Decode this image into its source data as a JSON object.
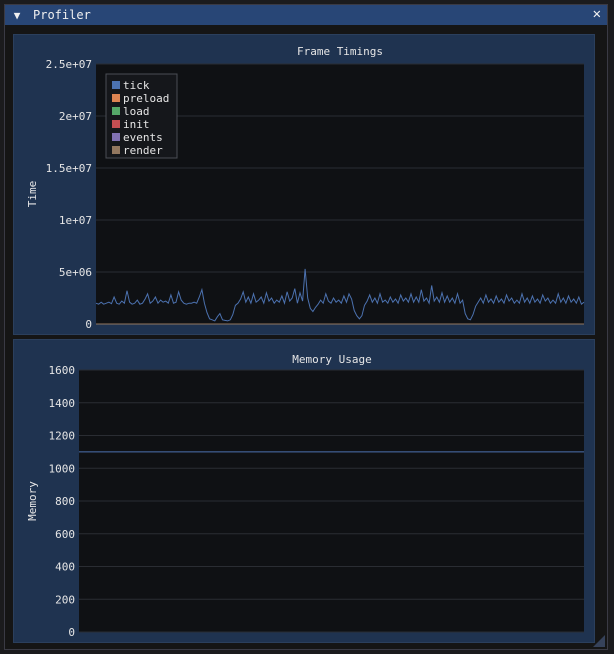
{
  "window": {
    "title": "Profiler",
    "collapse_glyph": "▼",
    "close_glyph": "✕"
  },
  "colors": {
    "titlebar": "#284676",
    "plot_bg": "#0f1114",
    "panel_bg": "#1f3350",
    "tick": "#4c72b0",
    "preload": "#dd8452",
    "load": "#55a868",
    "init": "#c44e52",
    "events": "#8172b3",
    "render": "#937860"
  },
  "chart_data": [
    {
      "type": "line",
      "title": "Frame Timings",
      "xlabel": "",
      "ylabel": "Time",
      "ylim": [
        0,
        25000000
      ],
      "yticks": [
        "0",
        "5e+06",
        "1e+07",
        "1.5e+07",
        "2e+07",
        "2.5e+07"
      ],
      "ytick_values": [
        0,
        5000000,
        10000000,
        15000000,
        20000000,
        25000000
      ],
      "legend": {
        "placement": "top-left"
      },
      "series": [
        {
          "name": "tick",
          "color": "#4c72b0",
          "values": [
            2000000,
            1900000,
            2100000,
            1900000,
            2000000,
            2100000,
            1950000,
            2600000,
            2000000,
            1900000,
            2200000,
            2000000,
            3200000,
            2100000,
            1900000,
            2000000,
            2300000,
            1900000,
            2000000,
            2400000,
            2900000,
            2000000,
            2200000,
            2600000,
            2000000,
            2300000,
            2100000,
            2200000,
            2000000,
            2800000,
            2000000,
            2100000,
            3100000,
            2300000,
            2000000,
            1900000,
            2000000,
            2000000,
            2100000,
            2000000,
            2600000,
            3300000,
            2000000,
            1100000,
            500000,
            400000,
            300000,
            700000,
            1000000,
            400000,
            350000,
            300000,
            400000,
            900000,
            1800000,
            2000000,
            2400000,
            3100000,
            2100000,
            2600000,
            2000000,
            2900000,
            2100000,
            2300000,
            2600000,
            2000000,
            3000000,
            2200000,
            2500000,
            2000000,
            2300000,
            2100000,
            2700000,
            2000000,
            3100000,
            2200000,
            2500000,
            3400000,
            2000000,
            3000000,
            2200000,
            5300000,
            2500000,
            1500000,
            1200000,
            1600000,
            1900000,
            2300000,
            2000000,
            2900000,
            2200000,
            2000000,
            2500000,
            2100000,
            2300000,
            2000000,
            2700000,
            2100000,
            2900000,
            2400000,
            1300000,
            800000,
            500000,
            800000,
            1800000,
            2200000,
            2800000,
            2100000,
            2500000,
            2000000,
            2900000,
            2100000,
            2300000,
            2000000,
            2600000,
            2100000,
            2400000,
            2000000,
            2800000,
            2200000,
            2500000,
            2100000,
            2900000,
            2100000,
            2600000,
            2100000,
            3300000,
            2200000,
            2500000,
            2000000,
            3700000,
            2200000,
            2600000,
            2100000,
            3000000,
            2100000,
            2700000,
            2100000,
            2500000,
            2000000,
            2900000,
            2000000,
            2300000,
            1000000,
            500000,
            400000,
            900000,
            1700000,
            2100000,
            2500000,
            2000000,
            2800000,
            2100000,
            2400000,
            2000000,
            2700000,
            2100000,
            2400000,
            2000000,
            2800000,
            2200000,
            2500000,
            2000000,
            2300000,
            2000000,
            2900000,
            2100000,
            2500000,
            2000000,
            2700000,
            2100000,
            2400000,
            2000000,
            2800000,
            2200000,
            2500000,
            2000000,
            2300000,
            2000000,
            2900000,
            2100000,
            2500000,
            2000000,
            2700000,
            2100000,
            2400000,
            2000000,
            2600000,
            1900000,
            2100000
          ]
        },
        {
          "name": "preload",
          "color": "#dd8452",
          "values": [
            0
          ]
        },
        {
          "name": "load",
          "color": "#55a868",
          "values": [
            0
          ]
        },
        {
          "name": "init",
          "color": "#c44e52",
          "values": [
            0
          ]
        },
        {
          "name": "events",
          "color": "#8172b3",
          "values": [
            0
          ]
        },
        {
          "name": "render",
          "color": "#937860",
          "values": [
            0
          ]
        }
      ]
    },
    {
      "type": "line",
      "title": "Memory Usage",
      "xlabel": "",
      "ylabel": "Memory",
      "ylim": [
        0,
        1600
      ],
      "yticks": [
        "0",
        "200",
        "400",
        "600",
        "800",
        "1000",
        "1200",
        "1400",
        "1600"
      ],
      "ytick_values": [
        0,
        200,
        400,
        600,
        800,
        1000,
        1200,
        1400,
        1600
      ],
      "series": [
        {
          "name": "",
          "color": "#4c72b0",
          "values": [
            1100,
            1100
          ]
        }
      ]
    }
  ]
}
